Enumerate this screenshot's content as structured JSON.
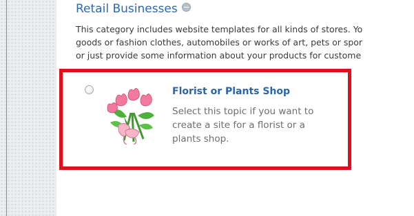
{
  "category": {
    "title": "Retail Businesses",
    "description_lines": [
      "This category includes website templates for all kinds of stores. Yo",
      "goods or fashion clothes, automobiles or works of art, pets or spor",
      "or just provide some information about your products for custome"
    ]
  },
  "option": {
    "title": "Florist or Plants Shop",
    "description_lines": [
      "Select this topic if you want to",
      "create a site for a florist or a",
      "plants shop."
    ],
    "selected": false,
    "icon": "flower-bouquet-icon"
  },
  "colors": {
    "highlight_border": "#e0101a",
    "link_blue": "#2b64a8"
  }
}
